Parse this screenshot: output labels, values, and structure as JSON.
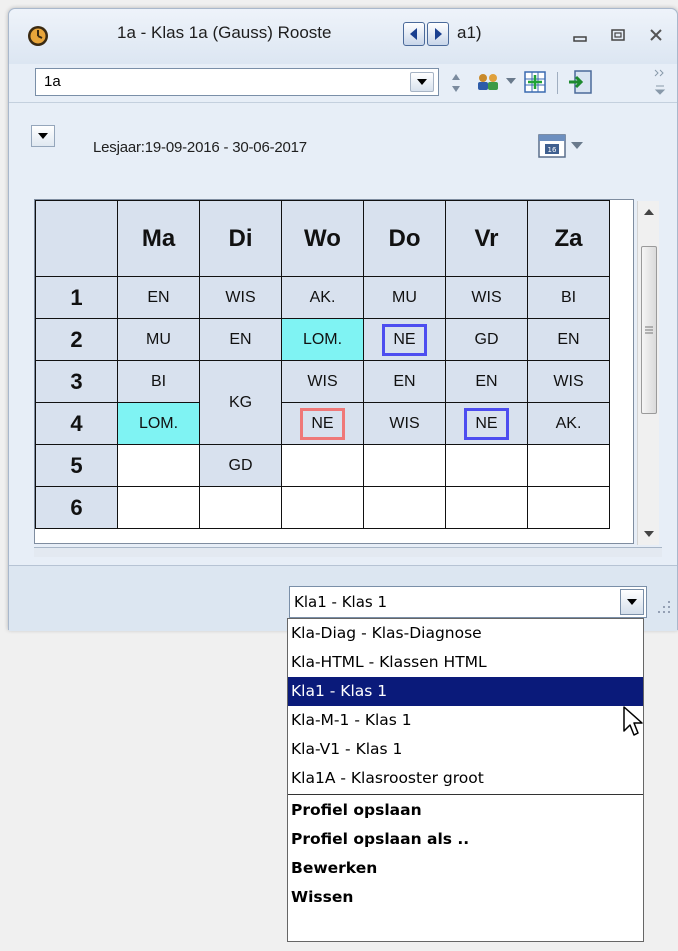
{
  "window": {
    "title": "1a - Klas 1a (Gauss)  Rooste",
    "title_tail": "a1)"
  },
  "toolbar": {
    "class_value": "1a"
  },
  "info": {
    "school_year": "Lesjaar:19-09-2016 - 30-06-2017"
  },
  "timetable": {
    "days": [
      "Ma",
      "Di",
      "Wo",
      "Do",
      "Vr",
      "Za"
    ],
    "periods": [
      "1",
      "2",
      "3",
      "4",
      "5",
      "6"
    ],
    "rows": [
      [
        "EN",
        "WIS",
        "AK.",
        "MU",
        "WIS",
        "BI"
      ],
      [
        "MU",
        "EN",
        "LOM.",
        "NE",
        "GD",
        "EN"
      ],
      [
        "BI",
        "KG",
        "WIS",
        "EN",
        "EN",
        "WIS"
      ],
      [
        "LOM.",
        "",
        "NE",
        "WIS",
        "NE",
        "AK."
      ],
      [
        "",
        "GD",
        "",
        "",
        "",
        ""
      ],
      [
        "",
        "",
        "",
        "",
        "",
        ""
      ]
    ]
  },
  "profile": {
    "selected": "Kla1 - Klas 1",
    "options": [
      "Kla-Diag - Klas-Diagnose",
      "Kla-HTML - Klassen HTML",
      "Kla1 - Klas 1",
      "Kla-M-1 - Klas 1",
      "Kla-V1 - Klas 1",
      "Kla1A - Klasrooster groot"
    ],
    "actions": [
      "Profiel opslaan",
      "Profiel opslaan als ..",
      "Bewerken",
      "Wissen"
    ]
  }
}
